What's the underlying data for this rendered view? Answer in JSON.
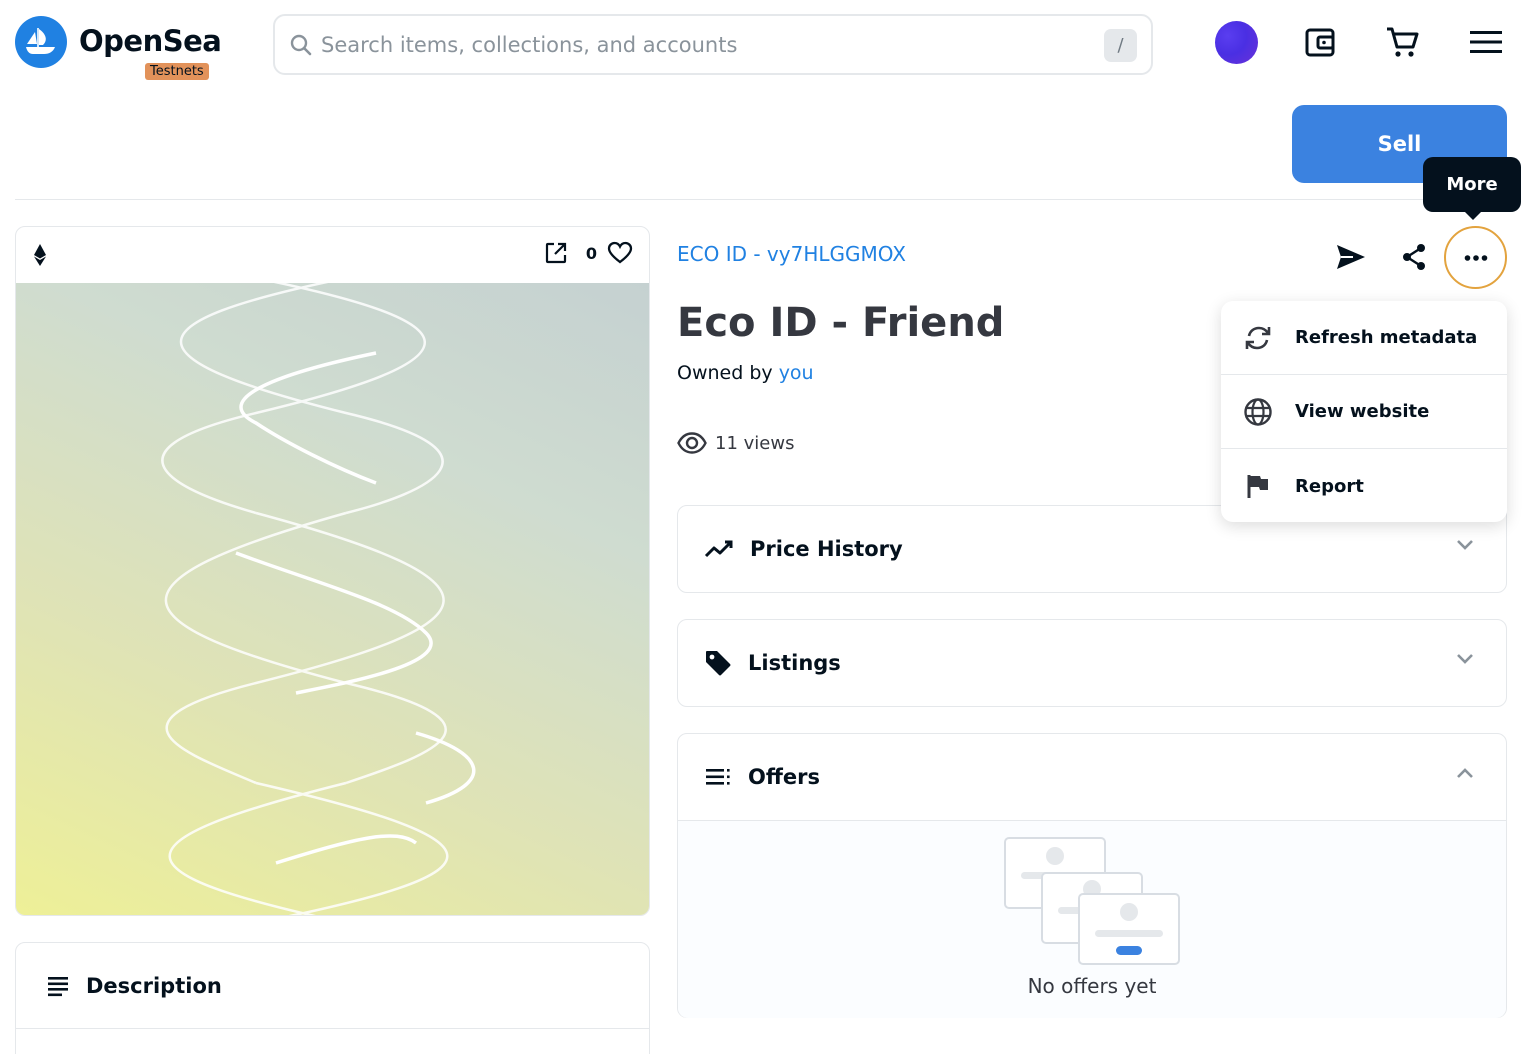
{
  "brand": {
    "name": "OpenSea",
    "badge": "Testnets",
    "color": "#2081e2"
  },
  "search": {
    "placeholder": "Search items, collections, and accounts",
    "shortcut": "/"
  },
  "header_icons": [
    "avatar",
    "wallet-icon",
    "cart-icon",
    "menu-icon"
  ],
  "actions": {
    "sell_label": "Sell"
  },
  "image_card": {
    "chain_icon": "ethereum-icon",
    "favorite_count": "0"
  },
  "asset": {
    "collection": "ECO ID - vy7HLGGMOX",
    "title": "Eco ID - Friend",
    "owned_prefix": "Owned by",
    "owner": "you",
    "views": "11 views"
  },
  "tooltip": {
    "text": "More"
  },
  "more_menu": {
    "items": [
      {
        "label": "Refresh metadata",
        "icon": "refresh-icon"
      },
      {
        "label": "View website",
        "icon": "globe-icon"
      },
      {
        "label": "Report",
        "icon": "flag-icon"
      }
    ]
  },
  "sections": {
    "price_history": {
      "title": "Price History",
      "expanded": false
    },
    "listings": {
      "title": "Listings",
      "expanded": false
    },
    "offers": {
      "title": "Offers",
      "expanded": true,
      "empty_text": "No offers yet"
    },
    "description": {
      "title": "Description"
    }
  }
}
